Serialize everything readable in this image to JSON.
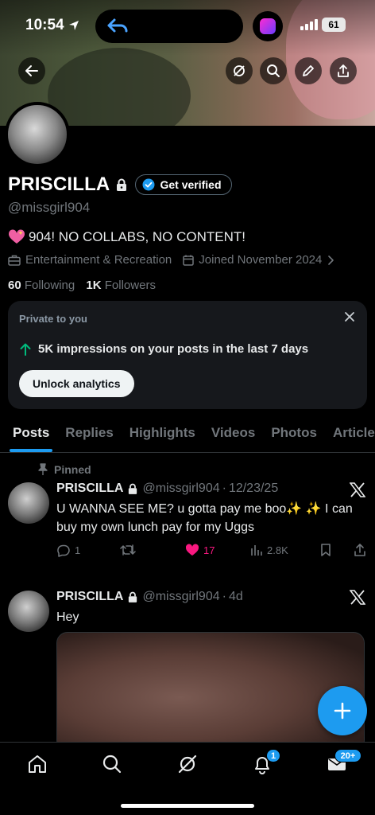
{
  "status_bar": {
    "time": "10:54",
    "battery": "61"
  },
  "profile": {
    "name": "PRISCILLA",
    "get_verified": "Get verified",
    "handle": "@missgirl904",
    "bio": "904! NO COLLABS, NO CONTENT!",
    "category": "Entertainment & Recreation",
    "joined": "Joined November 2024",
    "following_count": "60",
    "following_label": "Following",
    "followers_count": "1K",
    "followers_label": "Followers"
  },
  "analytics_card": {
    "label": "Private to you",
    "impressions": "5K impressions on your posts in the last 7 days",
    "button": "Unlock analytics"
  },
  "tabs": [
    {
      "label": "Posts",
      "active": true
    },
    {
      "label": "Replies"
    },
    {
      "label": "Highlights"
    },
    {
      "label": "Videos"
    },
    {
      "label": "Photos"
    },
    {
      "label": "Articles"
    }
  ],
  "pinned_label": "Pinned",
  "posts": [
    {
      "name": "PRISCILLA",
      "handle": "@missgirl904",
      "time": "12/23/25",
      "text": "U WANNA SEE ME? u gotta pay me boo✨ ✨ I can buy my own lunch pay for my Uggs",
      "replies": "1",
      "retweets": "",
      "likes": "17",
      "views": "2.8K"
    },
    {
      "name": "PRISCILLA",
      "handle": "@missgirl904",
      "time": "4d",
      "text": "Hey"
    }
  ],
  "nav": {
    "notifications_badge": "1",
    "messages_badge": "20+"
  },
  "colors": {
    "accent": "#1d9bf0",
    "like": "#f91880",
    "green": "#00ba7c"
  }
}
